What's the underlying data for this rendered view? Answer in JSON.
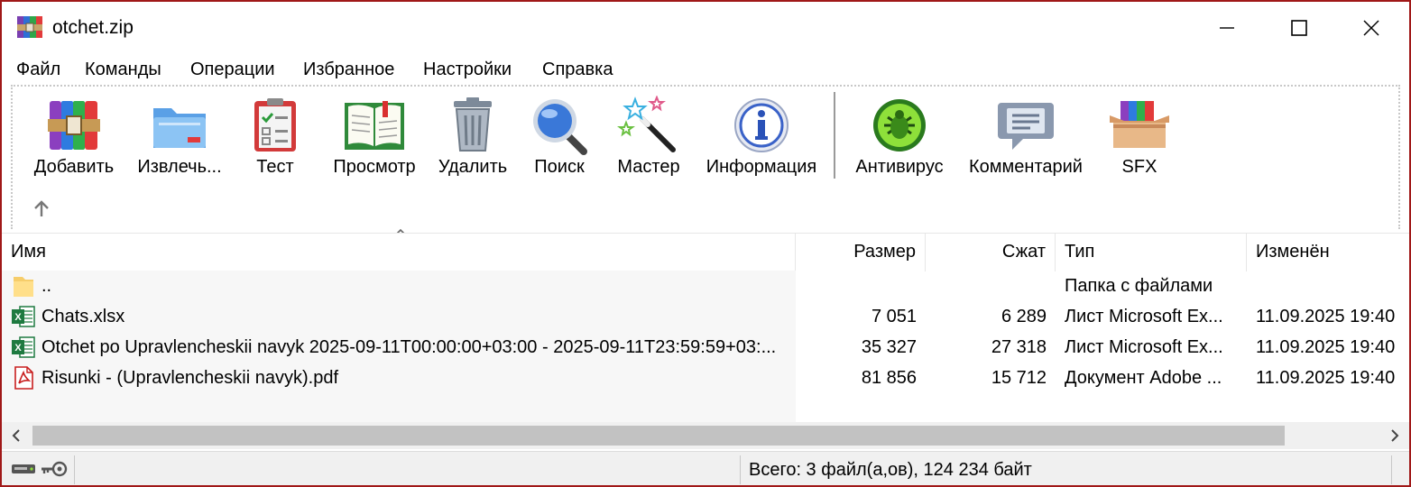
{
  "window": {
    "title": "otchet.zip",
    "minimize_icon": "minimize-icon",
    "maximize_icon": "maximize-icon",
    "close_icon": "close-icon"
  },
  "menu": [
    "Файл",
    "Команды",
    "Операции",
    "Избранное",
    "Настройки",
    "Справка"
  ],
  "toolbar": [
    {
      "label": "Добавить",
      "icon": "add-archive-icon"
    },
    {
      "label": "Извлечь...",
      "icon": "extract-folder-icon"
    },
    {
      "label": "Тест",
      "icon": "test-clipboard-icon"
    },
    {
      "label": "Просмотр",
      "icon": "view-book-icon"
    },
    {
      "label": "Удалить",
      "icon": "trash-icon"
    },
    {
      "label": "Поиск",
      "icon": "magnifier-icon"
    },
    {
      "label": "Мастер",
      "icon": "wizard-wand-icon"
    },
    {
      "label": "Информация",
      "icon": "info-icon"
    },
    {
      "label": "Антивирус",
      "icon": "antivirus-bug-icon"
    },
    {
      "label": "Комментарий",
      "icon": "comment-icon"
    },
    {
      "label": "SFX",
      "icon": "sfx-box-icon"
    }
  ],
  "columns": {
    "name": "Имя",
    "size": "Размер",
    "packed": "Сжат",
    "type": "Тип",
    "modified": "Изменён"
  },
  "rows": [
    {
      "name": "..",
      "size": "",
      "packed": "",
      "type": "Папка с файлами",
      "modified": "",
      "icon": "folder-icon"
    },
    {
      "name": "Chats.xlsx",
      "size": "7 051",
      "packed": "6 289",
      "type": "Лист Microsoft Ex...",
      "modified": "11.09.2025 19:40",
      "icon": "excel-file-icon"
    },
    {
      "name": "Otchet po Upravlencheskii navyk 2025-09-11T00:00:00+03:00 - 2025-09-11T23:59:59+03:...",
      "size": "35 327",
      "packed": "27 318",
      "type": "Лист Microsoft Ex...",
      "modified": "11.09.2025 19:40",
      "icon": "excel-file-icon"
    },
    {
      "name": "Risunki - (Upravlencheskii navyk).pdf",
      "size": "81 856",
      "packed": "15 712",
      "type": "Документ Adobe ...",
      "modified": "11.09.2025 19:40",
      "icon": "pdf-file-icon"
    }
  ],
  "status": {
    "summary": "Всего: 3 файл(а,ов), 124 234 байт"
  }
}
